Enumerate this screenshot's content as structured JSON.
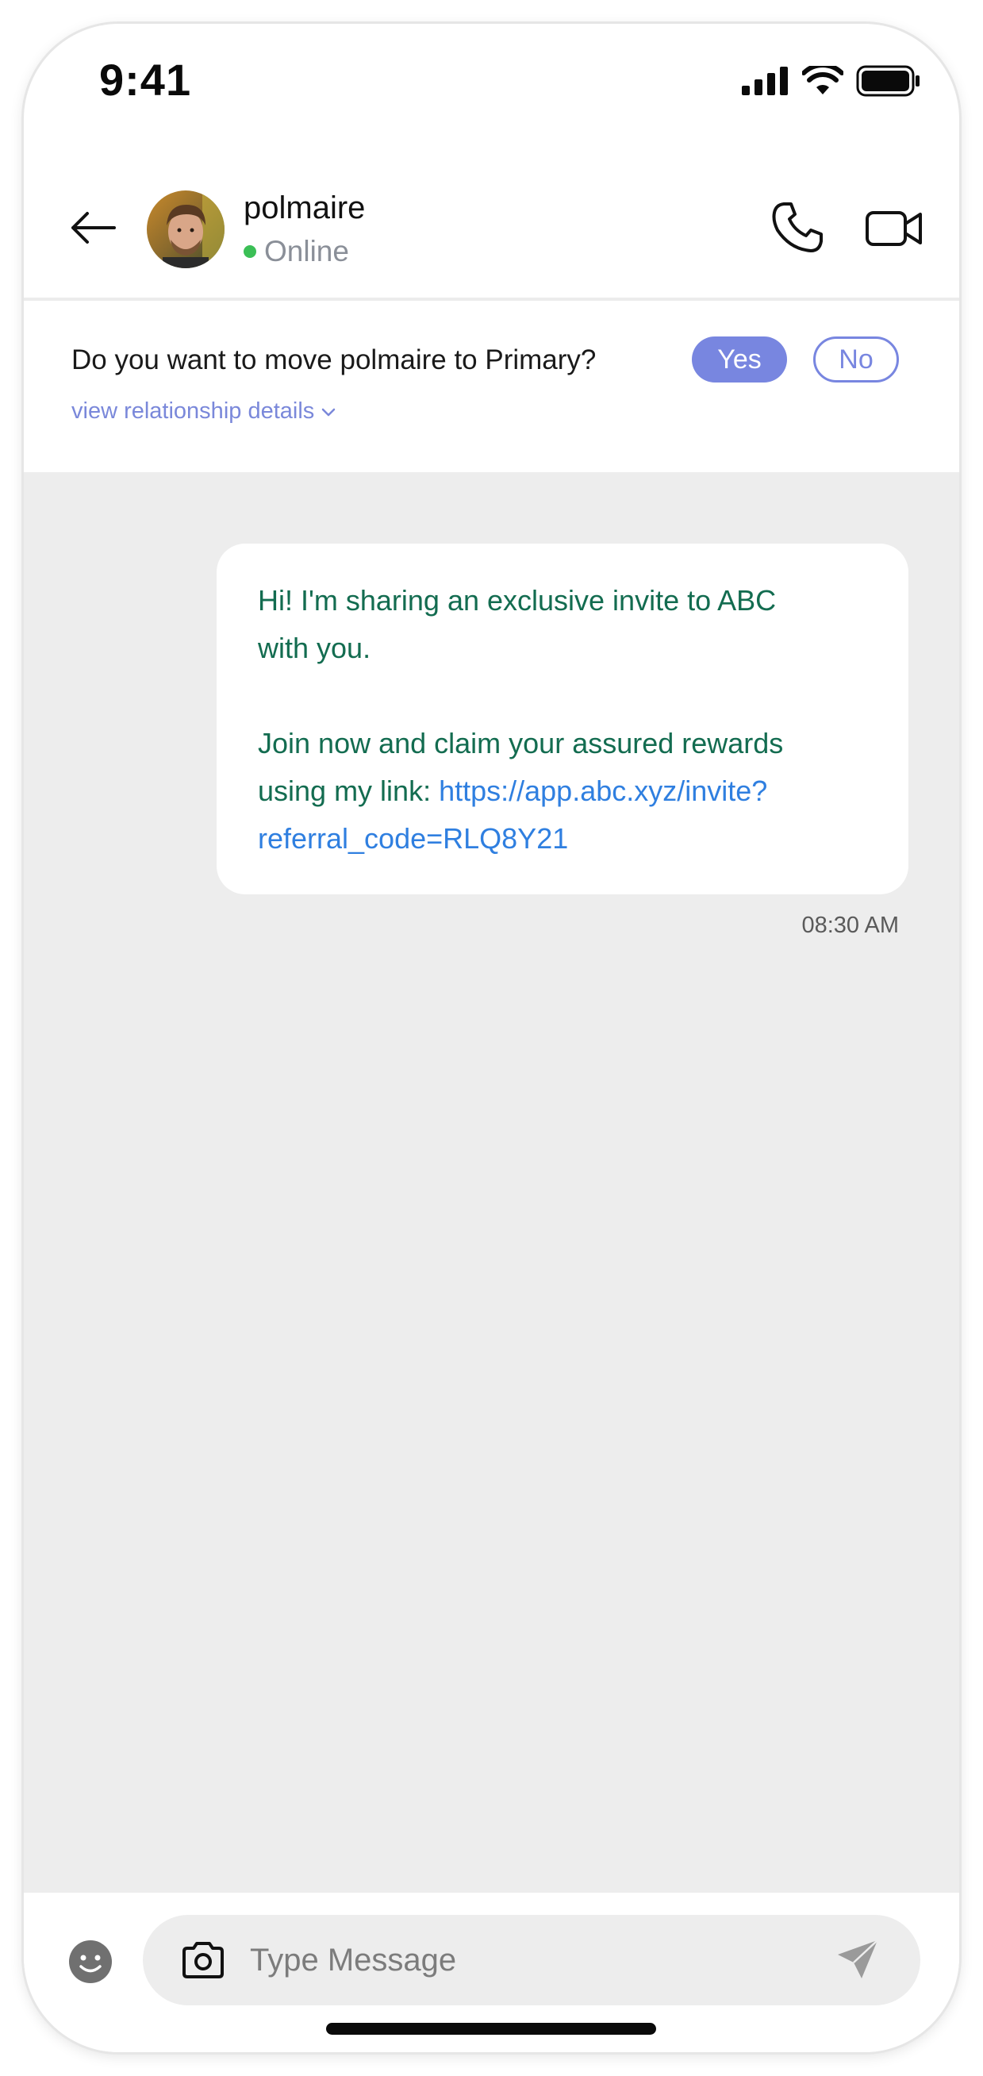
{
  "status_bar": {
    "time": "9:41"
  },
  "header": {
    "contact_name": "polmaire",
    "presence": "Online"
  },
  "prompt": {
    "question": "Do you want to move polmaire to Primary?",
    "yes_label": "Yes",
    "no_label": "No",
    "details_link": "view relationship details"
  },
  "message": {
    "line1": "Hi! I'm sharing an exclusive invite to ABC",
    "line2": "with you.",
    "line3": "Join now and claim your assured rewards",
    "line4_prefix": "using my link: ",
    "link_part1": "https://app.abc.xyz/invite?",
    "link_part2": "referral_code=RLQ8Y21",
    "time": "08:30 AM"
  },
  "composer": {
    "placeholder": "Type Message"
  },
  "colors": {
    "accent": "#7886e0",
    "message_text": "#136c50",
    "link": "#2f7fe0",
    "online": "#3bbf56",
    "chat_background": "#ededed"
  }
}
